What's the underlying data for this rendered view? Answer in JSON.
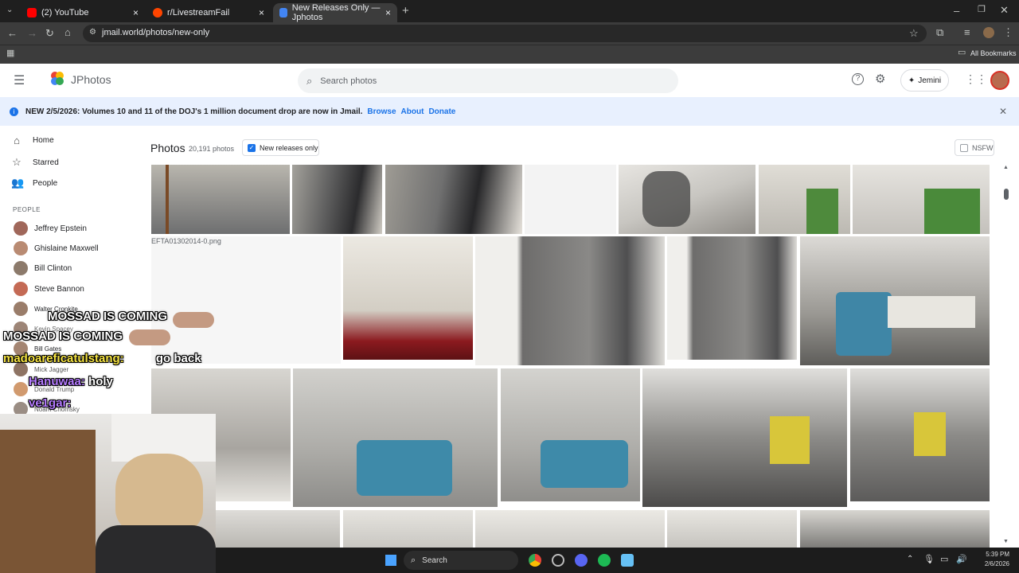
{
  "browser": {
    "tabs": [
      {
        "label": "(2) YouTube",
        "color": "#ff0000"
      },
      {
        "label": "r/LivestreamFail",
        "color": "#ff4500"
      },
      {
        "label": "New Releases Only — Jphotos",
        "color": "#4285f4"
      }
    ],
    "new_tab": "+",
    "url": "jmail.world/photos/new-only",
    "all_bookmarks": "All Bookmarks"
  },
  "app": {
    "name": "JPhotos",
    "search_placeholder": "Search photos",
    "jemini_label": "Jemini"
  },
  "notice": {
    "text": "NEW 2/5/2026: Volumes 10 and 11 of the DOJ's 1 million document drop are now in Jmail.",
    "browse": "Browse",
    "about": "About",
    "donate": "Donate"
  },
  "sidebar": {
    "nav": [
      {
        "label": "Home",
        "icon": "home-icon"
      },
      {
        "label": "Starred",
        "icon": "star-icon"
      },
      {
        "label": "People",
        "icon": "people-icon"
      }
    ],
    "people_header": "PEOPLE",
    "people": [
      {
        "name": "Jeffrey Epstein"
      },
      {
        "name": "Ghislaine Maxwell"
      },
      {
        "name": "Bill Clinton"
      },
      {
        "name": "Steve Bannon"
      },
      {
        "name": "Walter Cronkite"
      },
      {
        "name": "Kevin Spacey"
      },
      {
        "name": "Bill Gates"
      },
      {
        "name": "Mick Jagger"
      },
      {
        "name": "Donald Trump"
      },
      {
        "name": "Noam Chomsky"
      }
    ]
  },
  "photos": {
    "title": "Photos",
    "count": "20,191 photos",
    "filter_label": "New releases only",
    "filter_checked": true,
    "nsfw_label": "NSFW",
    "broken_image_label": "EFTA01302014-0.png"
  },
  "chat": [
    {
      "user": "",
      "text": "MOSSAD IS COMING"
    },
    {
      "user": "",
      "text": "MOSSAD IS COMING"
    },
    {
      "user": "madoareficatulstang:",
      "text": "go back",
      "color": "#f5e342"
    },
    {
      "user": "Hanuwaa:",
      "text": "holy",
      "color": "#b57bff"
    },
    {
      "user": "ve1gar:",
      "text": "",
      "color": "#b57bff"
    }
  ],
  "taskbar": {
    "search": "Search",
    "time": "5:39 PM",
    "date": "2/6/2026"
  }
}
